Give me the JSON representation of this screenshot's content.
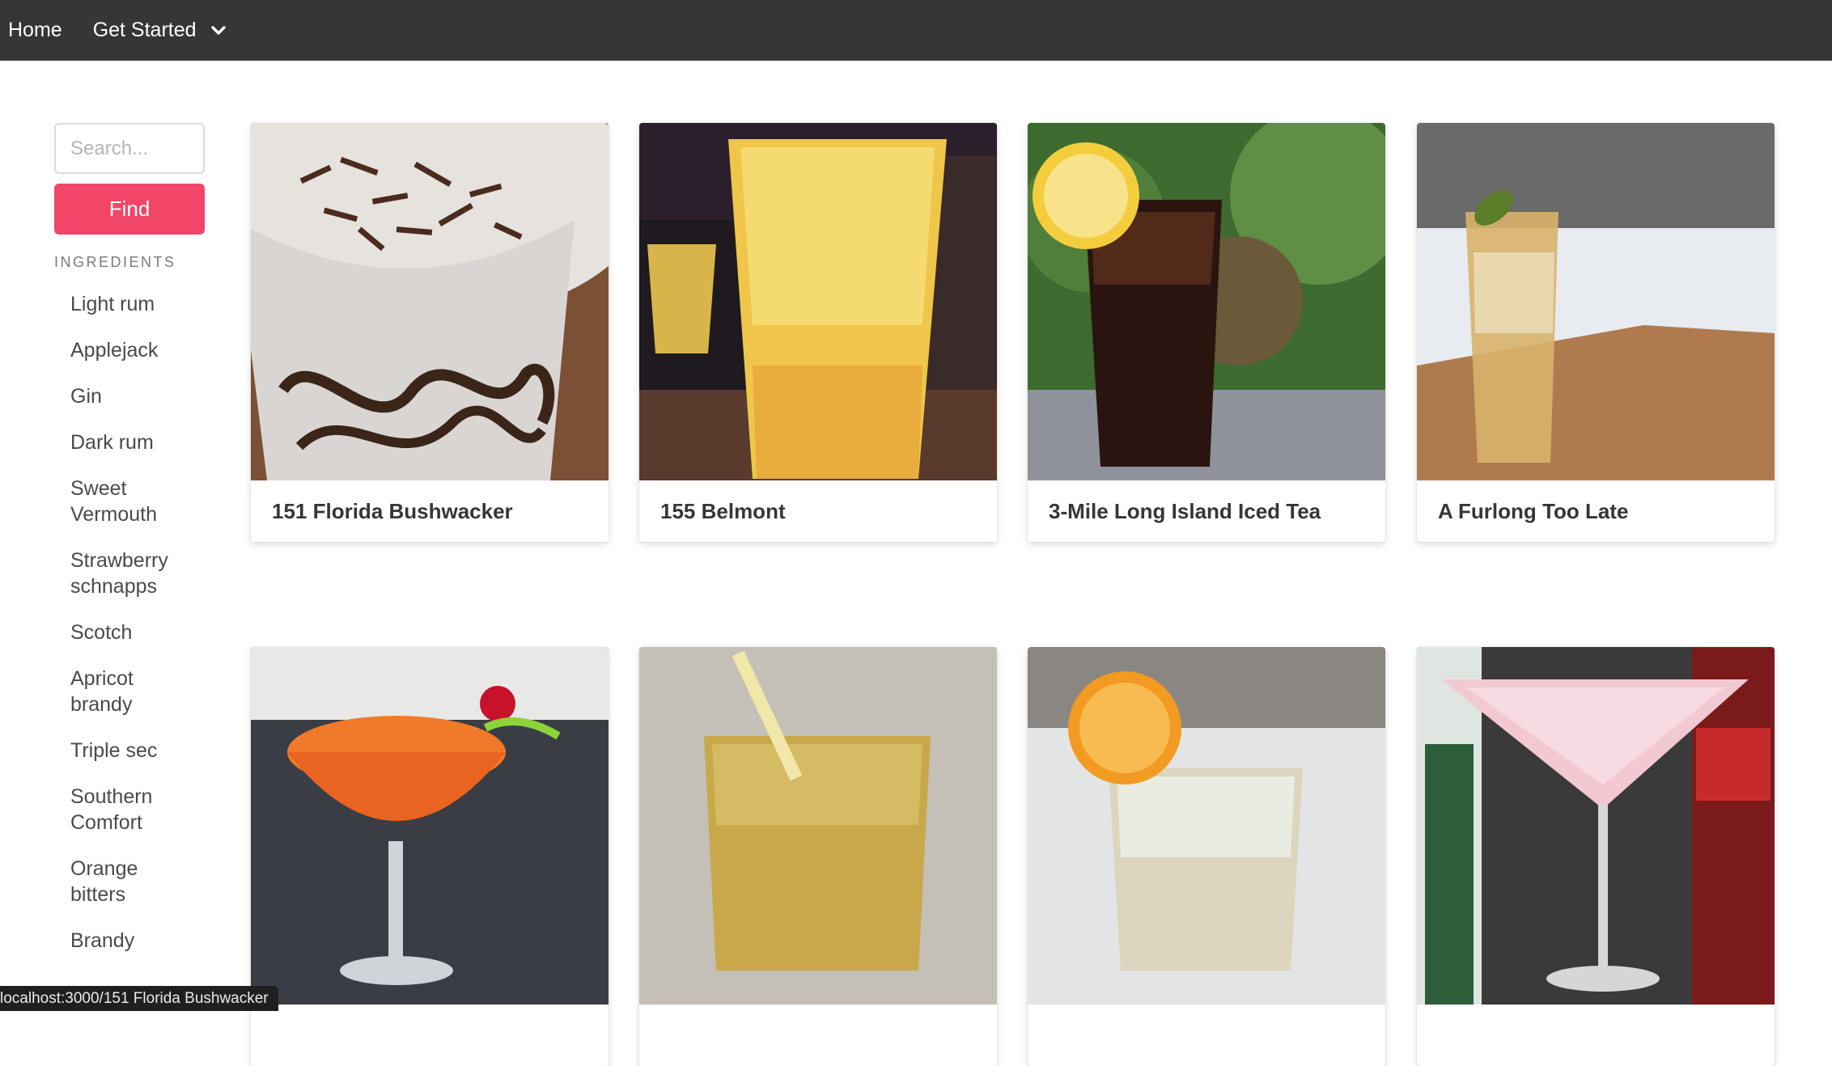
{
  "navbar": {
    "home_label": "Home",
    "get_started_label": "Get Started"
  },
  "sidebar": {
    "search_placeholder": "Search...",
    "find_label": "Find",
    "ingredients_label": "INGREDIENTS",
    "ingredients": [
      "Light rum",
      "Applejack",
      "Gin",
      "Dark rum",
      "Sweet Vermouth",
      "Strawberry schnapps",
      "Scotch",
      "Apricot brandy",
      "Triple sec",
      "Southern Comfort",
      "Orange bitters",
      "Brandy"
    ]
  },
  "cards": [
    {
      "title": "151 Florida Bushwacker"
    },
    {
      "title": "155 Belmont"
    },
    {
      "title": "3-Mile Long Island Iced Tea"
    },
    {
      "title": "A Furlong Too Late"
    },
    {
      "title": ""
    },
    {
      "title": ""
    },
    {
      "title": ""
    },
    {
      "title": ""
    }
  ],
  "status_bar": {
    "url": "localhost:3000/151 Florida Bushwacker"
  },
  "colors": {
    "navbar": "#363636",
    "accent": "#f14668"
  }
}
